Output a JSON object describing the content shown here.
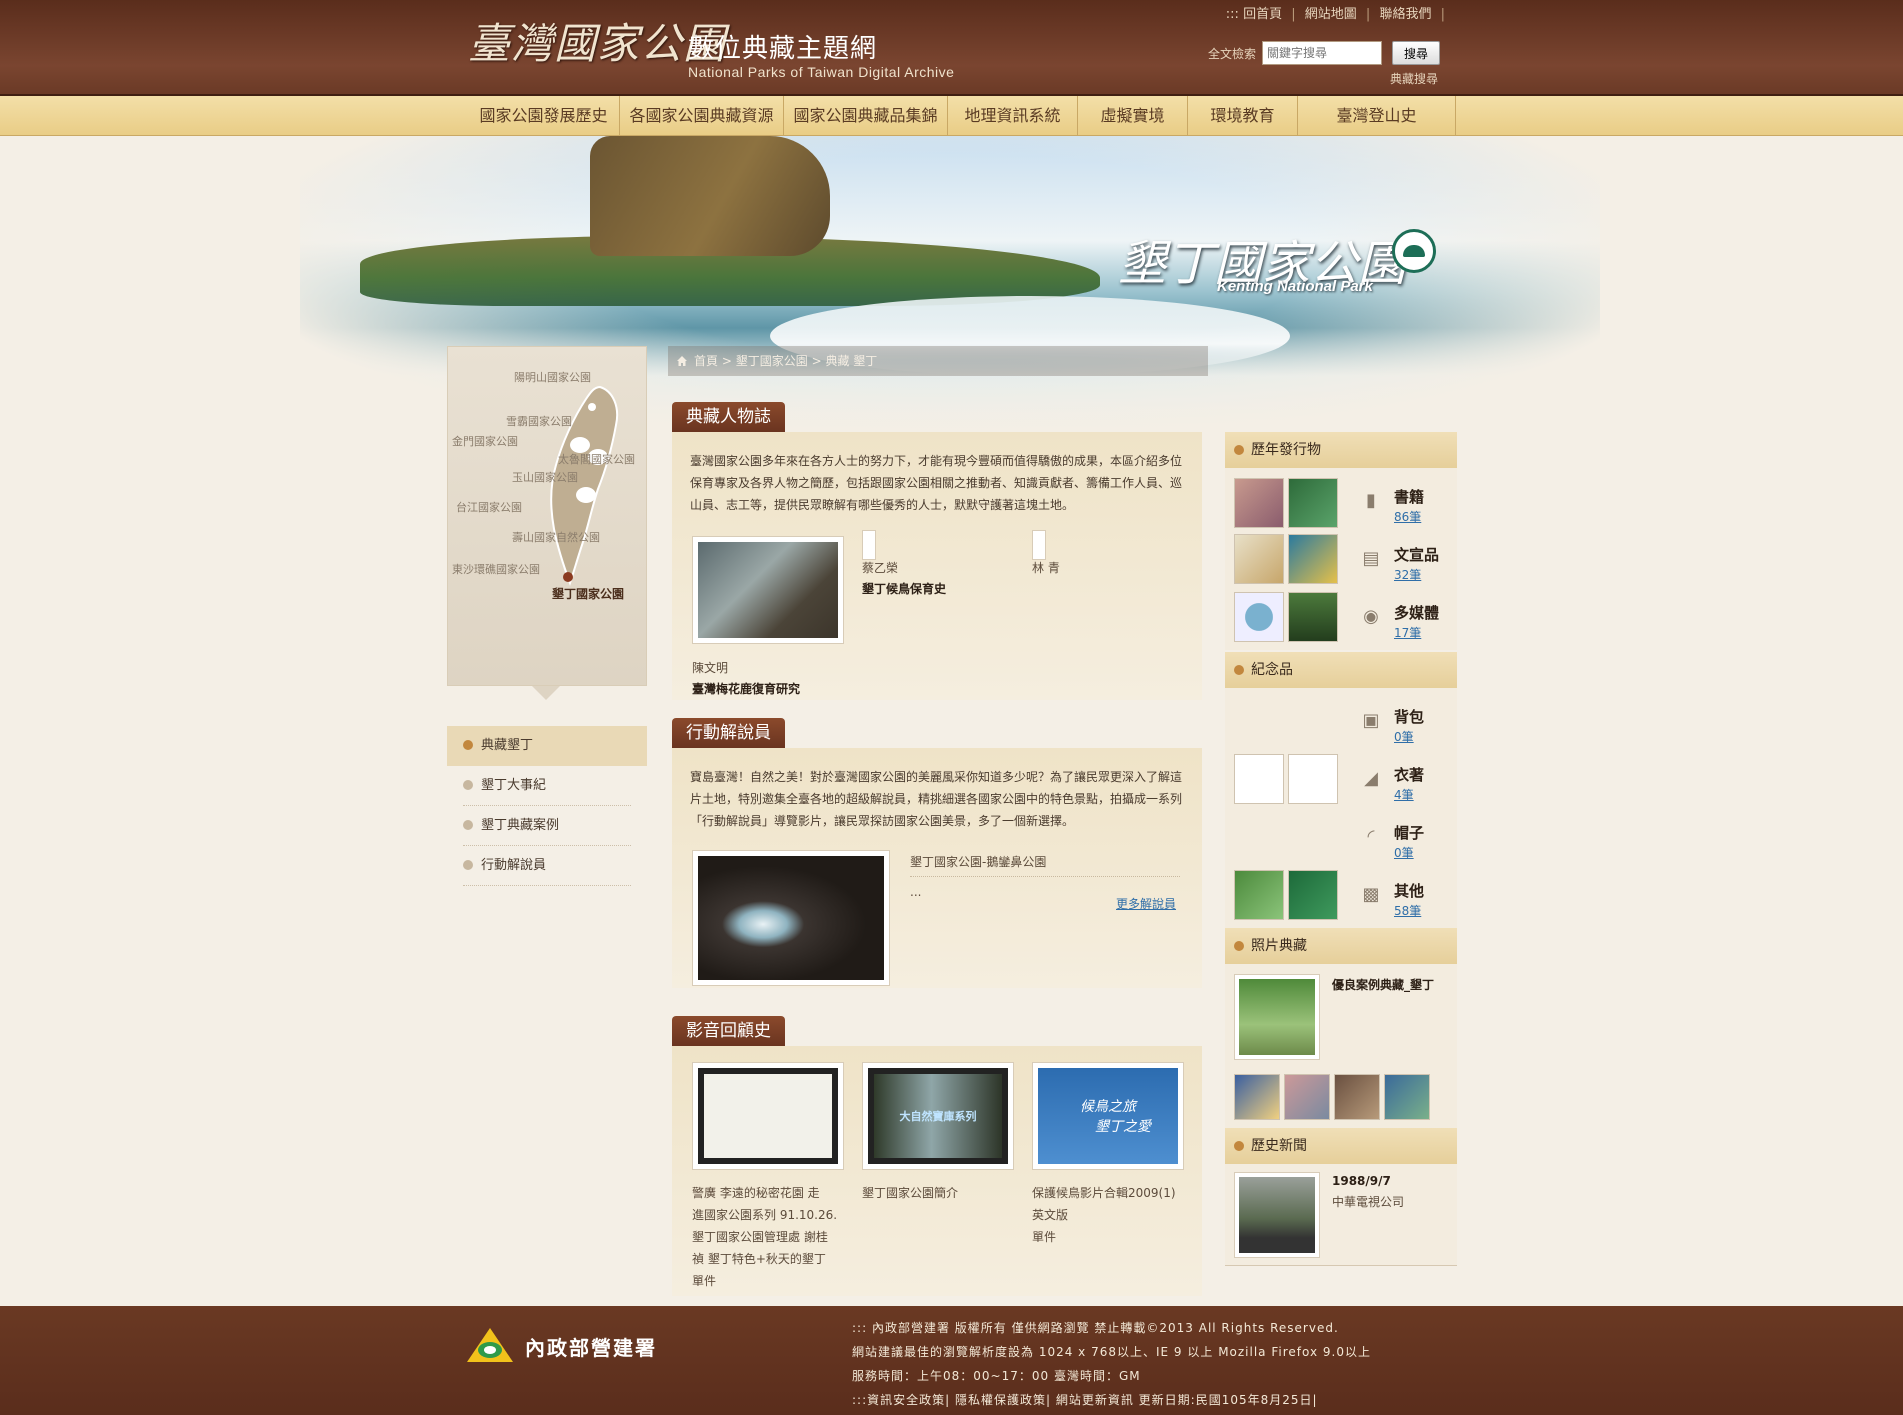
{
  "header": {
    "logo_zh": "臺灣國家公園",
    "title_zh": "數位典藏主題網",
    "title_en": "National Parks of Taiwan Digital Archive",
    "toplinks": [
      ":::",
      "回首頁",
      "網站地圖",
      "聯絡我們"
    ],
    "search": {
      "label": "全文檢索",
      "placeholder": "關鍵字搜尋",
      "button": "搜尋",
      "advanced": "典藏搜尋"
    }
  },
  "nav": [
    "國家公園發展歷史",
    "各國家公園典藏資源",
    "國家公園典藏品集錦",
    "地理資訊系統",
    "虛擬實境",
    "環境教育",
    "臺灣登山史"
  ],
  "hero": {
    "park_zh": "墾丁國家公園",
    "park_en": "Kenting National Park"
  },
  "breadcrumb": {
    "items": [
      "首頁",
      "墾丁國家公園",
      "典藏 墾丁"
    ],
    "sep": ">"
  },
  "map": {
    "labels": [
      "陽明山國家公園",
      "雪霸國家公園",
      "金門國家公園",
      "太魯閣國家公園",
      "玉山國家公園",
      "台江國家公園",
      "壽山國家自然公園",
      "東沙環礁國家公園",
      "墾丁國家公園"
    ]
  },
  "left_menu": [
    "典藏墾丁",
    "墾丁大事紀",
    "墾丁典藏案例",
    "行動解說員"
  ],
  "people": {
    "tab": "典藏人物誌",
    "intro": "臺灣國家公園多年來在各方人士的努力下，才能有現今豐碩而值得驕傲的成果，本區介紹多位保育專家及各界人物之簡歷，包括跟國家公園相關之推動者、知識貢獻者、籌備工作人員、巡山員、志工等，提供民眾瞭解有哪些優秀的人士，默默守護著這塊土地。",
    "items": [
      {
        "name": "蔡乙榮",
        "topic": "墾丁候鳥保育史"
      },
      {
        "name": "林 青",
        "topic": ""
      },
      {
        "name": "陳文明",
        "topic": "臺灣梅花鹿復育研究"
      }
    ]
  },
  "guide": {
    "tab": "行動解說員",
    "intro": "寶島臺灣！自然之美！對於臺灣國家公園的美麗風采你知道多少呢？為了讓民眾更深入了解這片土地，特別邀集全臺各地的超級解說員，精挑細選各國家公園中的特色景點，拍攝成一系列「行動解說員」導覽影片，讓民眾探訪國家公園美景，多了一個新選擇。",
    "video_title": "墾丁國家公園-鵝鑾鼻公園",
    "ellipsis": "...",
    "more": "更多解說員"
  },
  "av": {
    "tab": "影音回顧史",
    "items": [
      {
        "caption": [
          "警廣 李遠的秘密花園 走",
          "進國家公園系列 91.10.26.",
          "墾丁國家公園管理處 謝桂",
          "禎 墾丁特色+秋天的墾丁"
        ],
        "unit": "單件"
      },
      {
        "caption": [
          "墾丁國家公園簡介"
        ],
        "unit": ""
      },
      {
        "caption": [
          "保護候鳥影片合輯2009(1)",
          "英文版"
        ],
        "unit": "單件"
      }
    ],
    "thumb2_text": "大自然寶庫系列",
    "thumb3_text": [
      "候鳥之旅",
      "墾丁之愛"
    ]
  },
  "publications": {
    "title": "歷年發行物",
    "cats": [
      {
        "name": "書籍",
        "count": "86筆",
        "icon": "book-icon"
      },
      {
        "name": "文宣品",
        "count": "32筆",
        "icon": "map-icon"
      },
      {
        "name": "多媒體",
        "count": "17筆",
        "icon": "camera-icon"
      }
    ]
  },
  "souvenirs": {
    "title": "紀念品",
    "cats": [
      {
        "name": "背包",
        "count": "0筆",
        "icon": "backpack-icon"
      },
      {
        "name": "衣著",
        "count": "4筆",
        "icon": "shirt-icon"
      },
      {
        "name": "帽子",
        "count": "0筆",
        "icon": "hat-icon"
      },
      {
        "name": "其他",
        "count": "58筆",
        "icon": "gift-icon"
      }
    ]
  },
  "photos": {
    "title": "照片典藏",
    "caption": "優良案例典藏_墾丁"
  },
  "news": {
    "title": "歷史新聞",
    "date": "1988/9/7",
    "source": "中華電視公司"
  },
  "footer": {
    "org": "內政部營建署",
    "lines": [
      "::: 內政部營建署 版權所有 僅供網路瀏覽 禁止轉載©2013 All Rights Reserved.",
      "網站建議最佳的瀏覽解析度設為 1024 x 768以上、IE 9 以上 Mozilla Firefox 9.0以上",
      "服務時間：上午08：00~17：00 臺灣時間：GM",
      ":::資訊安全政策| 隱私權保護政策| 網站更新資訊 更新日期:民國105年8月25日|"
    ]
  }
}
